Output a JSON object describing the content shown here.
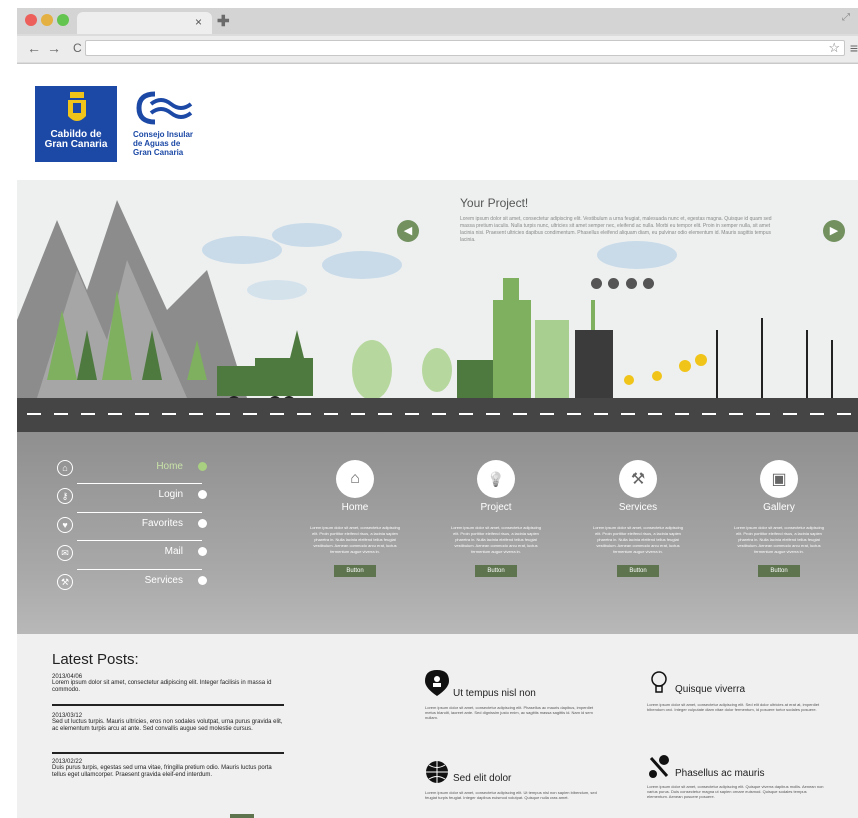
{
  "browser": {
    "tab_close": "×",
    "new_tab": "✚",
    "back": "←",
    "forward": "→",
    "reload": "C",
    "star": "☆",
    "menu": "≡",
    "colors": {
      "close": "#ec5f5a",
      "min": "#e4b041",
      "max": "#63c44f"
    }
  },
  "header": {
    "logo1_line1": "Cabildo de",
    "logo1_line2": "Gran Canaria",
    "logo2_line1": "Consejo Insular",
    "logo2_line2": "de Aguas de",
    "logo2_line3": "Gran Canaria"
  },
  "hero": {
    "title": "Your Project!",
    "text": "Lorem ipsum dolor sit amet, consectetur adipiscing elit. Vestibulum a urna feugiat, malesuada nunc et, egestas magna. Quisque id quam sed massa pretium iaculis. Nulla turpis nunc, ultricies sit amet semper nec, eleifend ac nulla. Morbi eu tempor elit. Proin in semper nulla, sit amet lacinia nisi. Praesent ultricies dapibus condimentum. Phasellus eleifend aliquam diam, eu pulvinar odio elementum id. Mauris sagittis tempus lacinia.",
    "prev": "◀",
    "next": "▶"
  },
  "sidenav": {
    "items": [
      {
        "label": "Home",
        "icon": "home-icon",
        "glyph": "⌂"
      },
      {
        "label": "Login",
        "icon": "key-icon",
        "glyph": "⚷"
      },
      {
        "label": "Favorites",
        "icon": "heart-icon",
        "glyph": "♥"
      },
      {
        "label": "Mail",
        "icon": "mail-icon",
        "glyph": "✉"
      },
      {
        "label": "Services",
        "icon": "tools-icon",
        "glyph": "⚒"
      }
    ]
  },
  "cards": [
    {
      "title": "Home",
      "icon": "home-icon",
      "glyph": "⌂",
      "body": "Lorem ipsum dolor sit amet, consectetur adipiscing elit. Proin porttitor eleifend risus, a lacinia sapien pharetra in. Nulla lacinia eleifend tellus feugiat vestibulum. Aenean commodo arcu erat, luctus fermentum augue viverra in.",
      "button": "Button"
    },
    {
      "title": "Project",
      "icon": "lightbulb-icon",
      "glyph": "💡",
      "body": "Lorem ipsum dolor sit amet, consectetur adipiscing elit. Proin porttitor eleifend risus, a lacinia sapien pharetra in. Nulla lacinia eleifend tellus feugiat vestibulum. Aenean commodo arcu erat, luctus fermentum augue viverra in.",
      "button": "Button"
    },
    {
      "title": "Services",
      "icon": "tools-icon",
      "glyph": "⚒",
      "body": "Lorem ipsum dolor sit amet, consectetur adipiscing elit. Proin porttitor eleifend risus, a lacinia sapien pharetra in. Nulla lacinia eleifend tellus feugiat vestibulum. Aenean commodo arcu erat, luctus fermentum augue viverra in.",
      "button": "Button"
    },
    {
      "title": "Gallery",
      "icon": "image-icon",
      "glyph": "▣",
      "body": "Lorem ipsum dolor sit amet, consectetur adipiscing elit. Proin porttitor eleifend risus, a lacinia sapien pharetra in. Nulla lacinia eleifend tellus feugiat vestibulum. Aenean commodo arcu erat, luctus fermentum augue viverra in.",
      "button": "Button"
    }
  ],
  "latest": {
    "title": "Latest Posts:",
    "posts": [
      {
        "date": "2013/04/06",
        "text": "Lorem ipsum dolor sit amet, consectetur adipiscing elit. Integer facilisis in massa id commodo."
      },
      {
        "date": "2013/03/12",
        "text": "Sed ut luctus turpis. Mauris ultricies, eros non sodales volutpat, urna purus gravida elit, ac elementum turpis arcu at ante. Sed convallis augue sed molestie cursus."
      },
      {
        "date": "2013/02/22",
        "text": "Duis purus turpis, egestas sed urna vitae, fringilla pretium odio. Mauris luctus porta tellus eget ullamcorper.  Praesent gravida eleif-end interdum."
      }
    ]
  },
  "features": [
    {
      "title": "Ut tempus nisl non",
      "icon": "location-person-icon",
      "text": "Lorem ipsum dolor sit amet, consectetur adipiscing elit. Phasellus ac mauris dapibus, imperdiet metus blandit, laoreet ante. Sed dignissim justo enim, ac sagittis massa sagittis id. Nam id sem nullam."
    },
    {
      "title": "Quisque viverra",
      "icon": "lightbulb-icon",
      "text": "Lorem ipsum dolor sit amet, consectetur adipiscing elit. Sed elit dolor ultricies at erat at, imperdiet bibendum orci. Integer vulputate diam vitae dolor fermentum, id posuere tortor sodales posuere."
    },
    {
      "title": "Sed elit dolor",
      "icon": "globe-icon",
      "text": "Lorem ipsum dolor sit amet, consectetur adipiscing elit. Ut tempus nisl non sapien bibendum, sed feugiat turpis feugiat. Integer dapibus euismod volutpat. Quisque nulla cras amet."
    },
    {
      "title": "Phasellus ac mauris",
      "icon": "tools-icon",
      "text": "Lorem ipsum dolor sit amet, consectetur adipiscing elit. Quisque viverra dapibus mollis. Aenean non varius purus. Duis consectetur magna ut sapien ornare euismod. Quisque sodales tempus elementum. Aenean posuere posuere."
    }
  ]
}
